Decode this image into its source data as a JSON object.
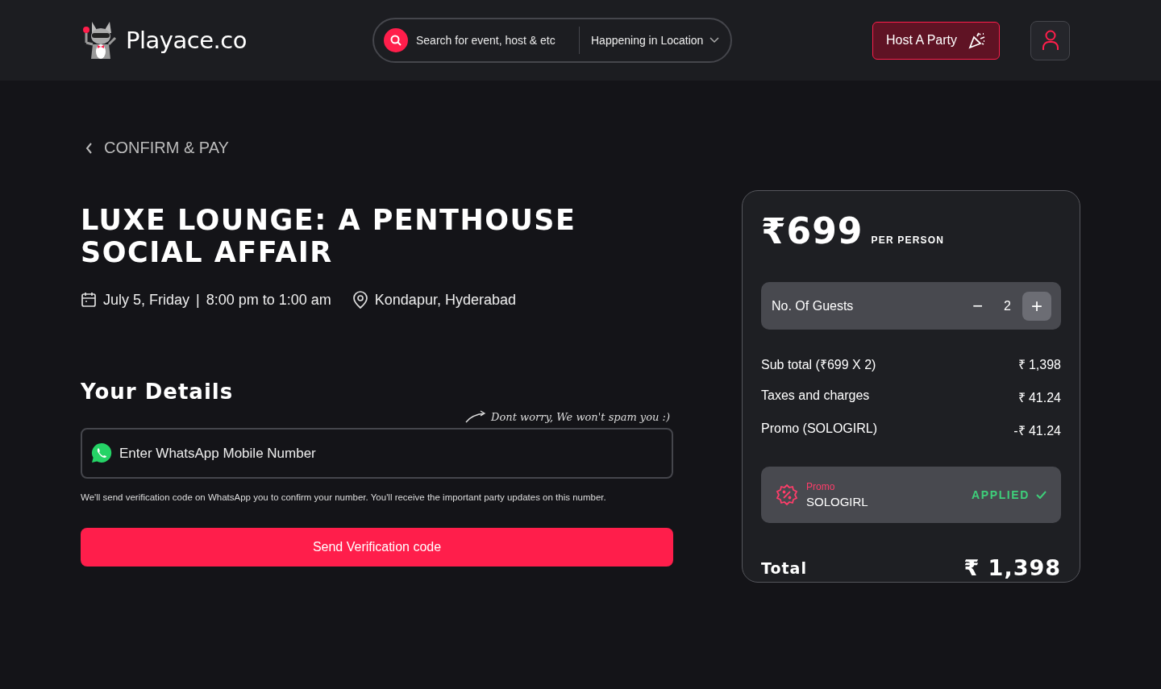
{
  "header": {
    "brand": "Playace.co",
    "search": {
      "placeholder": "Search for event, host & etc"
    },
    "location": "Happening in Location",
    "host_button": "Host A Party"
  },
  "back": "CONFIRM & PAY",
  "event": {
    "title": "LUXE LOUNGE: A PENTHOUSE SOCIAL AFFAIR",
    "date": "July 5, Friday",
    "separator": "|",
    "time": "8:00 pm to 1:00 am",
    "location": "Kondapur, Hyderabad"
  },
  "details": {
    "heading": "Your Details",
    "note": "Dont worry, We won't spam you :)",
    "phone": {
      "placeholder": "Enter WhatsApp Mobile Number"
    },
    "help": "We'll send verification code on WhatsApp you to confirm your number. You'll receive the important party updates on this number.",
    "button": "Send Verification code"
  },
  "summary": {
    "price": "₹699",
    "unit": "PER PERSON",
    "guests": {
      "label": "No. Of Guests",
      "minus": "−",
      "count": "2",
      "plus": "+"
    },
    "lines": [
      {
        "label": "Sub total (₹699 X 2)",
        "amount": "₹ 1,398"
      },
      {
        "label": "Taxes and charges",
        "amount": "₹ 41.24"
      },
      {
        "label": "Promo (SOLOGIRL)",
        "amount": "-₹ 41.24"
      }
    ],
    "promo": {
      "label": "Promo",
      "code": "SOLOGIRL",
      "status": "APPLIED",
      "applied": true
    },
    "total_label": "Total",
    "total": "₹ 1,398"
  }
}
